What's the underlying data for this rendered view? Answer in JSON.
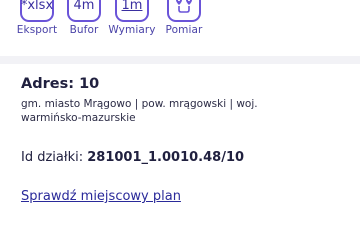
{
  "toolbar": {
    "items": [
      {
        "label": "Eksport",
        "icon_text": "*xlsx",
        "icon": "export-xlsx-icon"
      },
      {
        "label": "Bufor",
        "icon_text": "4m",
        "icon": "buffer-icon"
      },
      {
        "label": "Wymiary",
        "icon_text": "1m",
        "icon": "dimensions-icon"
      },
      {
        "label": "Pomiar",
        "icon_text": "",
        "icon": "measure-pins-icon"
      }
    ]
  },
  "address": {
    "label": "Adres: 10",
    "location": "gm. miasto Mrągowo | pow. mrągowski | woj. warmińsko-mazurskie"
  },
  "parcel": {
    "label": "Id działki:",
    "value": "281001_1.0010.48/10"
  },
  "links": {
    "plan": "Sprawdź miejscowy plan"
  },
  "colors": {
    "accent": "#6a54d8",
    "text": "#20203f"
  }
}
